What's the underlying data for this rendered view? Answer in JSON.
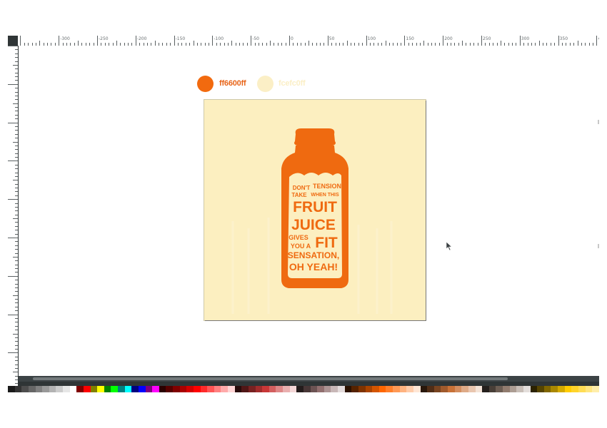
{
  "colors": {
    "accent_orange": "#ff6600",
    "cream": "#fcefc0",
    "ui_dark": "#2f3536"
  },
  "ruler": {
    "lock_icon": "lock-icon",
    "top_labels": [
      "-300",
      "-250",
      "-200",
      "-150",
      "-100",
      "-50",
      "0",
      "50",
      "100",
      "150",
      "200",
      "250",
      "300",
      "350",
      "400"
    ]
  },
  "swatches": [
    {
      "label": "ff6600ff",
      "color": "#ff6600"
    },
    {
      "label": "fcefc0ff",
      "color": "#fcefc0"
    }
  ],
  "artwork": {
    "lines": [
      [
        "DON'T",
        "TENSION"
      ],
      [
        "TAKE",
        "WHEN THIS"
      ],
      [
        "FRUIT"
      ],
      [
        "JUICE"
      ],
      [
        "GIVES",
        "FIT"
      ],
      [
        "YOU A"
      ],
      [
        "SENSATION,"
      ],
      [
        "OH YEAH!"
      ]
    ]
  },
  "palette": [
    "#1a1a1a",
    "#333333",
    "#4d4d4d",
    "#666666",
    "#808080",
    "#999999",
    "#b3b3b3",
    "#cccccc",
    "#e6e6e6",
    "#ffffff",
    "#800000",
    "#ff0000",
    "#808000",
    "#ffff00",
    "#008000",
    "#00ff00",
    "#008080",
    "#00ffff",
    "#000080",
    "#0000ff",
    "#800080",
    "#ff00ff",
    "#2b0000",
    "#550000",
    "#800000",
    "#aa0000",
    "#d40000",
    "#ff0000",
    "#ff2a2a",
    "#ff5555",
    "#ff8080",
    "#ffaaaa",
    "#ffd5d5",
    "#280b0b",
    "#501616",
    "#782121",
    "#a02c2c",
    "#c83737",
    "#d35f5f",
    "#de8787",
    "#e9afaf",
    "#f4d7d7",
    "#241c1c",
    "#483737",
    "#6c5353",
    "#916f6f",
    "#ac9393",
    "#c8b7b7",
    "#e3dbdb",
    "#2b1100",
    "#552200",
    "#803300",
    "#aa4400",
    "#d45500",
    "#ff6600",
    "#ff7f2a",
    "#ff9955",
    "#ffb380",
    "#ffccaa",
    "#ffe6d5",
    "#28170b",
    "#502d16",
    "#784421",
    "#a05a2c",
    "#c87137",
    "#d38d5f",
    "#deaa87",
    "#e9c6af",
    "#f4e3d7",
    "#241f1c",
    "#483e37",
    "#6c5d53",
    "#917c6f",
    "#ac9d93",
    "#c8beb7",
    "#e3dedb",
    "#2b2200",
    "#554400",
    "#806600",
    "#aa8800",
    "#d4aa00",
    "#ffcc00",
    "#ffd42a",
    "#ffdd55",
    "#ffe680",
    "#ffeeaa"
  ]
}
